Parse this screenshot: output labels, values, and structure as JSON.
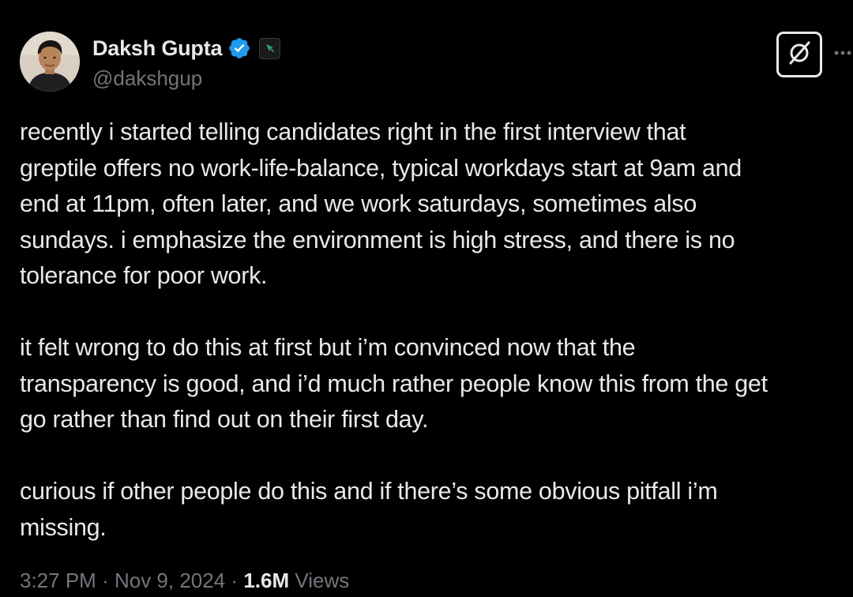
{
  "author": {
    "display_name": "Daksh Gupta",
    "handle": "@dakshgup",
    "verified_badge": "verified-badge-icon",
    "affiliation_badge": "affiliation-icon",
    "verified_color": "#1d9bf0"
  },
  "actions": {
    "grok_icon": "grok-icon",
    "more_icon": "more-icon"
  },
  "tweet": {
    "lines": [
      "recently i started telling candidates right in the first interview that",
      "greptile offers no work-life-balance, typical workdays start at 9am and",
      "end at 11pm, often later, and we work saturdays, sometimes also",
      "sundays. i emphasize the environment is high stress, and there is no",
      "tolerance for poor work.",
      "it felt wrong to do this at first but i’m convinced now that the",
      "transparency is good, and i’d much rather people know this from the get",
      "go rather than find out on their first day.",
      "curious if other people do this and if there’s some obvious pitfall i’m",
      "missing."
    ]
  },
  "meta": {
    "time": "3:27 PM",
    "separator": "·",
    "date": "Nov 9, 2024",
    "views_count": "1.6M",
    "views_label": "Views"
  },
  "colors": {
    "background": "#000000",
    "text": "#e7e9ea",
    "secondary": "#71767b"
  }
}
